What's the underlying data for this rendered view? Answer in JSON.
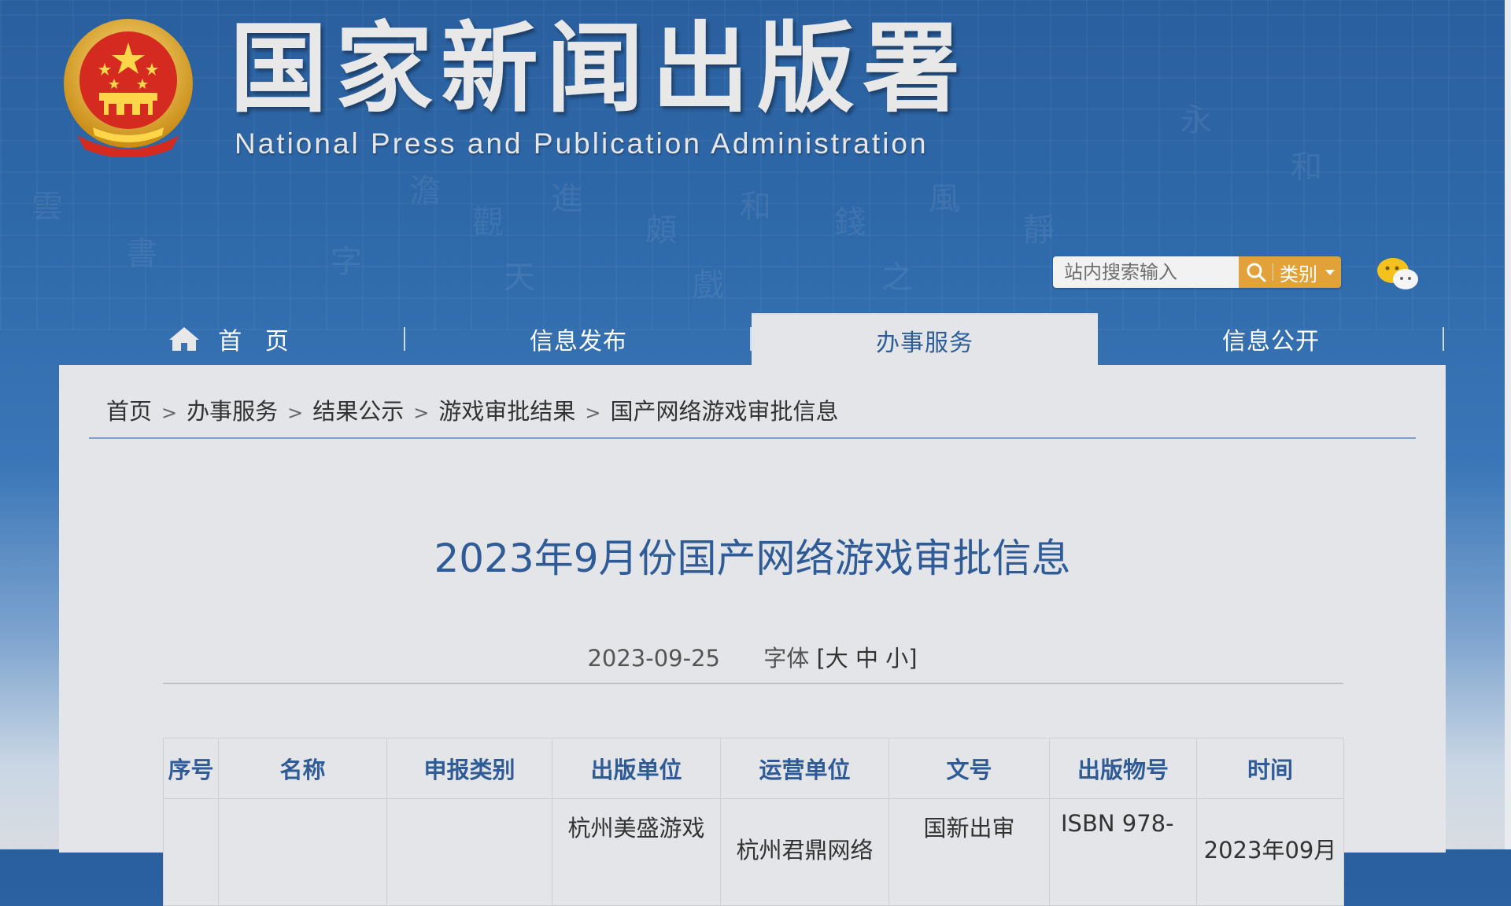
{
  "header": {
    "title_cn": "国家新闻出版署",
    "title_en": "National  Press and Publication Administration"
  },
  "search": {
    "placeholder": "站内搜索输入",
    "category_label": "类别"
  },
  "nav": {
    "items": [
      {
        "label": "首 页"
      },
      {
        "label": "信息发布"
      },
      {
        "label": "办事服务",
        "active": true
      },
      {
        "label": "信息公开"
      }
    ]
  },
  "breadcrumb": {
    "items": [
      "首页",
      "办事服务",
      "结果公示",
      "游戏审批结果",
      "国产网络游戏审批信息"
    ],
    "separator": ">"
  },
  "article": {
    "title": "2023年9月份国产网络游戏审批信息",
    "date": "2023-09-25",
    "font_size_label": "字体",
    "font_size_options": "[大 中 小]"
  },
  "table": {
    "headers": [
      "序号",
      "名称",
      "申报类别",
      "出版单位",
      "运营单位",
      "文号",
      "出版物号",
      "时间"
    ],
    "first_row": {
      "publisher": "杭州美盛游戏",
      "operator": "杭州君鼎网络",
      "doc_no": "国新出审",
      "isbn": "ISBN 978-",
      "time": "2023年09月"
    }
  },
  "colors": {
    "accent": "#e3a13a",
    "title_blue": "#2f5c97",
    "panel_bg": "#e3e5e8"
  }
}
